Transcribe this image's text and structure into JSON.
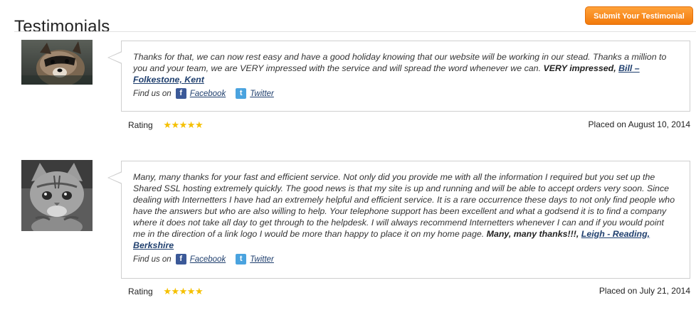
{
  "header": {
    "title": "Testimonials",
    "submit_label": "Submit Your Testimonial"
  },
  "testimonials": [
    {
      "avatar": "raccoon-photo",
      "text": "Thanks for that, we can now rest easy and have a good holiday knowing that our website will be working in our stead. Thanks a million to you and your team, we are VERY impressed with the service and will spread the word whenever we can.",
      "highlight": "VERY impressed,",
      "author": "Bill – Folkestone, Kent",
      "find_us_label": "Find us on",
      "facebook_label": "Facebook",
      "twitter_label": "Twitter",
      "rating_label": "Rating",
      "stars": "★★★★★",
      "rating_value": 5,
      "placed": "Placed on August 10, 2014"
    },
    {
      "avatar": "kitten-photo",
      "text": "Many, many thanks for your fast and efficient service. Not only did you provide me with all the information I required but you set up the Shared SSL hosting extremely quickly. The good news is that my site is up and running and will be able to accept orders very soon. Since dealing with Internetters I have had an extremely helpful and efficient service. It is a rare occurrence these days to not only find people who have the answers but who are also willing to help. Your telephone support has been excellent and what a godsend it is to find a company where it does not take all day to get through to the helpdesk. I will always recommend Internetters whenever I can and if you would point me in the direction of a link logo I would be more than happy to place it on my home page.",
      "highlight": "Many, many thanks!!!,",
      "author": "Leigh - Reading, Berkshire",
      "find_us_label": "Find us on",
      "facebook_label": "Facebook",
      "twitter_label": "Twitter",
      "rating_label": "Rating",
      "stars": "★★★★★",
      "rating_value": 5,
      "placed": "Placed on July 21, 2014"
    }
  ]
}
